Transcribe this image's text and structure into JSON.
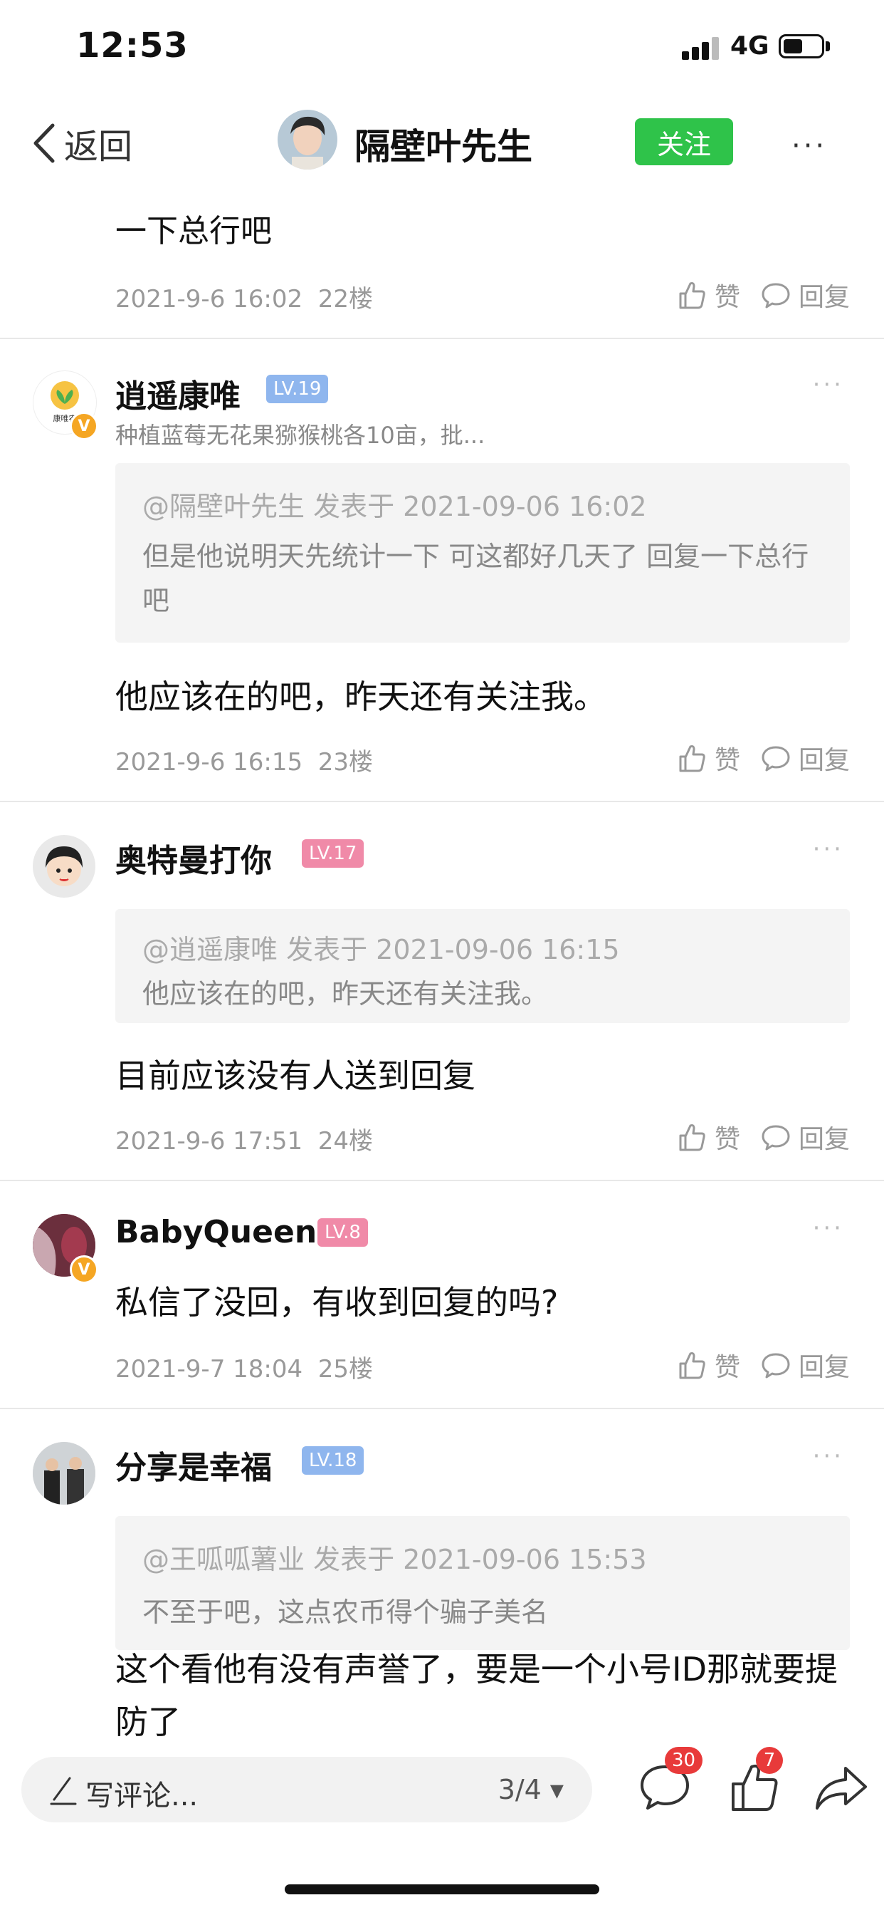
{
  "status_bar": {
    "time": "12:53",
    "network": "4G"
  },
  "header": {
    "back_label": "返回",
    "title": "隔壁叶先生",
    "follow_label": "关注",
    "more": "···"
  },
  "partial": {
    "text": "一下总行吧",
    "date": "2021-9-6 16:02",
    "floor": "22楼"
  },
  "actions": {
    "like_label": "赞",
    "reply_label": "回复"
  },
  "comments": [
    {
      "name": "逍遥康唯",
      "level": "LV.19",
      "subtitle": "种植蓝莓无花果猕猴桃各10亩，批...",
      "avatar_text": "康唯农",
      "quote_header": "@隔壁叶先生 发表于 2021-09-06 16:02",
      "quote_body": "但是他说明天先统计一下  可这都好几天了 回复一下总行吧",
      "text": "他应该在的吧，昨天还有关注我。",
      "date": "2021-9-6 16:15",
      "floor": "23楼"
    },
    {
      "name": "奥特曼打你",
      "level": "LV.17",
      "quote_header": "@逍遥康唯 发表于 2021-09-06 16:15",
      "quote_body": "他应该在的吧，昨天还有关注我。",
      "text": "目前应该没有人送到回复",
      "date": "2021-9-6 17:51",
      "floor": "24楼"
    },
    {
      "name": "BabyQueen",
      "level": "LV.8",
      "text": "私信了没回，有收到回复的吗?",
      "date": "2021-9-7 18:04",
      "floor": "25楼"
    },
    {
      "name": "分享是幸福",
      "level": "LV.18",
      "quote_header": "@王呱呱薯业 发表于 2021-09-06 15:53",
      "quote_body": "不至于吧，这点农币得个骗子美名",
      "text": "这个看他有没有声誉了，要是一个小号ID那就要提防了"
    }
  ],
  "bottom_bar": {
    "placeholder": "写评论...",
    "page_indicator": "3/4",
    "comment_count": "30",
    "like_count": "7"
  },
  "colors": {
    "follow_green": "#2fc34a",
    "level_blue": "#8fb6ee",
    "level_pink": "#f08aa8",
    "badge_red": "#e83a3a",
    "verified_orange": "#f5a623"
  }
}
